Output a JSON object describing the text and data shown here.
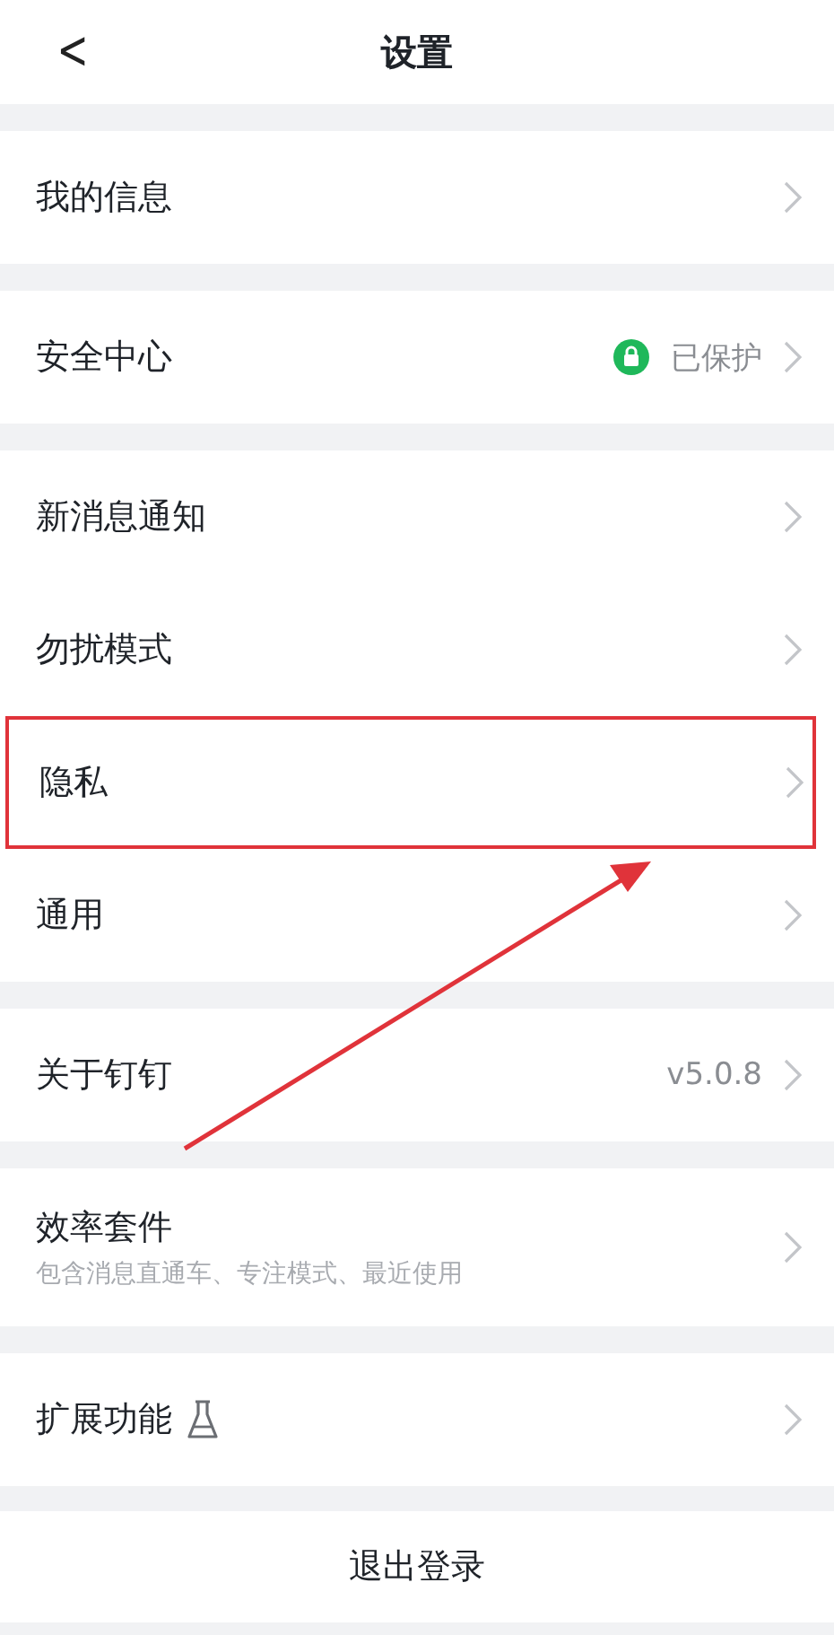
{
  "header": {
    "back": "<",
    "title": "设置"
  },
  "groups": [
    {
      "items": [
        {
          "kind": "plain",
          "label": "我的信息",
          "highlighted": false
        }
      ]
    },
    {
      "items": [
        {
          "kind": "status",
          "label": "安全中心",
          "value": "已保护",
          "highlighted": false
        }
      ]
    },
    {
      "items": [
        {
          "kind": "plain",
          "label": "新消息通知",
          "highlighted": false
        },
        {
          "kind": "plain",
          "label": "勿扰模式",
          "highlighted": false
        },
        {
          "kind": "plain",
          "label": "隐私",
          "highlighted": true
        },
        {
          "kind": "plain",
          "label": "通用",
          "highlighted": false
        }
      ]
    },
    {
      "items": [
        {
          "kind": "value",
          "label": "关于钉钉",
          "value": "v5.0.8",
          "highlighted": false
        }
      ]
    },
    {
      "items": [
        {
          "kind": "subtitle",
          "label": "效率套件",
          "subtitle": "包含消息直通车、专注模式、最近使用",
          "highlighted": false
        }
      ]
    },
    {
      "items": [
        {
          "kind": "lab",
          "label": "扩展功能",
          "highlighted": false
        }
      ]
    }
  ],
  "logout": "退出登录"
}
